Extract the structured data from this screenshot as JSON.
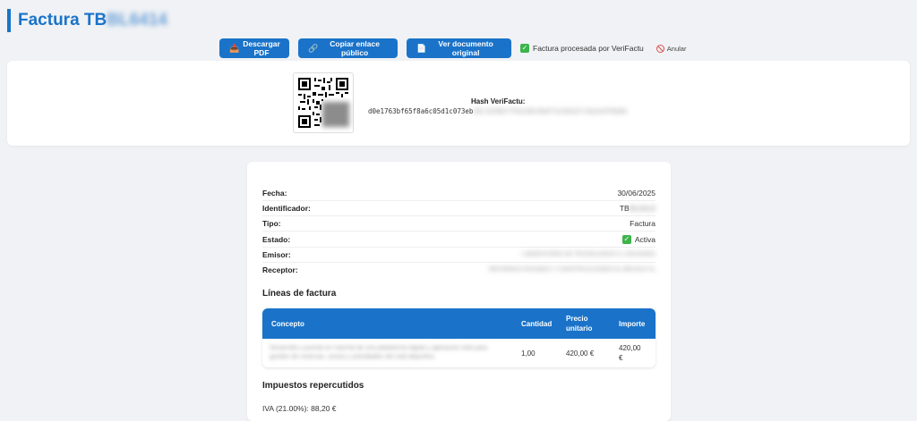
{
  "header": {
    "title_prefix": "Factura TB",
    "title_redacted": "BL6414"
  },
  "actions": {
    "download_pdf": "Descargar PDF",
    "copy_link": "Copiar enlace público",
    "view_original": "Ver documento original",
    "processed_status": "Factura procesada por VeriFactu",
    "annul": "Anular"
  },
  "verifactu": {
    "hash_label": "Hash VeriFactu:",
    "hash_visible": "d0e1763bf65f8a6c05d1c073eb",
    "hash_redacted": "a9c1b36b7f4e2d0c8a6f1e3b5d7c9a2e4f6b8d"
  },
  "details": {
    "fecha_label": "Fecha:",
    "fecha_value": "30/06/2025",
    "identificador_label": "Identificador:",
    "identificador_prefix": "TB",
    "identificador_redacted": "BL6414",
    "tipo_label": "Tipo:",
    "tipo_value": "Factura",
    "estado_label": "Estado:",
    "estado_value": "Activa",
    "emisor_label": "Emisor:",
    "emisor_redacted": "LABORATORIO DE TECNOLOGÍAS S. DIGANNES",
    "receptor_label": "Receptor:",
    "receptor_redacted": "REFORMAS ROSABLE Y CONSTRUCCIONES EL BRUSLE SL"
  },
  "lines": {
    "section_title": "Líneas de factura",
    "columns": [
      "Concepto",
      "Cantidad",
      "Precio unitario",
      "Importe"
    ],
    "rows": [
      {
        "concept_redacted": "Desarrollo y puesta en marcha de una plataforma digital y aplicación web para gestión de reservas, socios y actividades del club deportivo",
        "cantidad": "1,00",
        "precio": "420,00 €",
        "importe": "420,00 €"
      }
    ]
  },
  "taxes": {
    "section_title": "Impuestos repercutidos",
    "iva_line": "IVA (21.00%): 88,20 €"
  },
  "colors": {
    "primary": "#1a73c9",
    "success": "#3cb44b",
    "danger": "#d9534f",
    "background": "#f0f2f5"
  }
}
